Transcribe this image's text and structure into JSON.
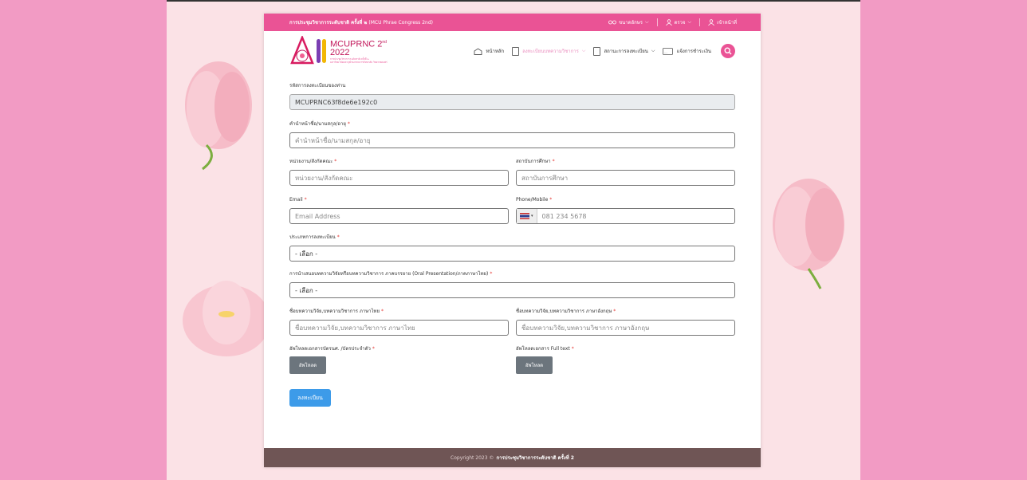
{
  "topbar": {
    "title": "การประชุมวิชาการระดับชาติ ครั้งที่ ๒",
    "subtitle": "(MCU Phrae Congress 2nd)",
    "items": [
      {
        "icon": "glasses-icon",
        "label": "ขนาดอักษร"
      },
      {
        "icon": "users-icon",
        "label": "ตรวจ"
      },
      {
        "icon": "user-icon",
        "label": "เข้าหน้าที่"
      }
    ]
  },
  "header": {
    "logo": {
      "line1": "MCUPRNC 2",
      "sup": "nd",
      "line2": "2022",
      "tiny1": "การประชุมวิชาการระดับชาติ ครั้งที่ ๒",
      "tiny2": "มหาวิทยาลัยมหาจุฬาลงกรณราชวิทยาลัย วิทยาเขตแพร่"
    },
    "nav": [
      {
        "label": "หน้าหลัก",
        "icon": "home-icon",
        "active": false,
        "dropdown": false
      },
      {
        "label": "ลงทะเบียนบทความวิชาการ",
        "icon": "document-icon",
        "active": true,
        "dropdown": true
      },
      {
        "label": "สถานะการลงทะเบียน",
        "icon": "document-icon",
        "active": false,
        "dropdown": true
      },
      {
        "label": "แจ้งการชำระเงิน",
        "icon": "message-icon",
        "active": false,
        "dropdown": false
      }
    ]
  },
  "form": {
    "reg_code": {
      "label": "รหัสการลงทะเบียนของท่าน",
      "value": "MCUPRNC63f8de6e192c0"
    },
    "prefix_name": {
      "label": "คำนำหน้าชื่อ/นามสกุล/อายุ",
      "placeholder": "คำนำหน้าชื่อ/นามสกุล/อายุ"
    },
    "department": {
      "label": "หน่วยงาน/สังกัดคณะ",
      "placeholder": "หน่วยงาน/สังกัดคณะ"
    },
    "institution": {
      "label": "สถาบันการศึกษา",
      "placeholder": "สถาบันการศึกษา"
    },
    "email": {
      "label": "Email",
      "placeholder": "Email Address"
    },
    "phone": {
      "label": "Phone/Mobile",
      "placeholder": "081 234 5678"
    },
    "reg_type": {
      "label": "ประเภทการลงทะเบียน",
      "value": "- เลือก -"
    },
    "presentation": {
      "label": "การนำเสนอบทความวิจัยหรือบทความวิชาการ ภาคบรรยาย (Oral Presentation/ภาคภาษาไทย)",
      "value": "- เลือก -"
    },
    "title_th": {
      "label": "ชื่อบทความวิจัย,บทความวิชาการ ภาษาไทย",
      "placeholder": "ชื่อบทความวิจัย,บทความวิชาการ ภาษาไทย"
    },
    "title_en": {
      "label": "ชื่อบทความวิจัย,บทความวิชาการ ภาษาอังกฤษ",
      "placeholder": "ชื่อบทความวิจัย,บทความวิชาการ ภาษาอังกฤษ"
    },
    "upload_id": {
      "label": "อัพโหลดเอกสารบัตรนศ. /บัตรประจำตัว",
      "button": "อัพโหลด"
    },
    "upload_full": {
      "label": "อัพโหลดเอกสาร Full text",
      "button": "อัพโหลด"
    },
    "submit": "ลงทะเบียน",
    "required_mark": "*"
  },
  "footer": {
    "text": "Copyright 2023 ©",
    "bold": "การประชุมวิชาการระดับชาติ ครั้งที่ 2"
  },
  "colors": {
    "pink": "#ea5395",
    "bg": "#f29bc4",
    "footer": "#6f5555",
    "submit": "#3d9be9"
  }
}
